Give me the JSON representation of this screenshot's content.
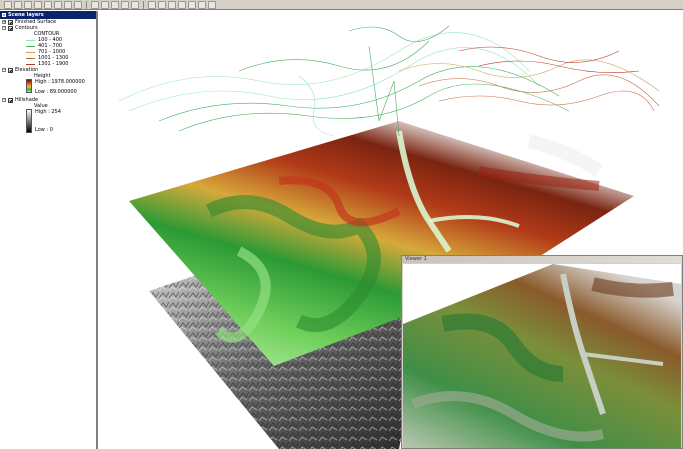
{
  "toolbar": {
    "buttons": [
      "new",
      "open",
      "save",
      "print",
      "cut",
      "copy",
      "paste",
      "delete",
      "add-data",
      "layer",
      "globe",
      "navigate",
      "fly",
      "zoom-in",
      "zoom-out",
      "pan",
      "full-extent",
      "select",
      "identify",
      "measure"
    ]
  },
  "toc": {
    "title": "Scene layers",
    "layers": [
      {
        "name": "Finished Surface",
        "checked": true,
        "expanded": false
      },
      {
        "name": "Contours",
        "checked": true,
        "expanded": true,
        "field": "CONTOUR",
        "classes": [
          {
            "label": "100 - 400",
            "color": "#9be3c6"
          },
          {
            "label": "401 - 700",
            "color": "#46b05a"
          },
          {
            "label": "701 - 1000",
            "color": "#c9a35b"
          },
          {
            "label": "1001 - 1300",
            "color": "#c86b3c"
          },
          {
            "label": "1301 - 1900",
            "color": "#b83a2a"
          }
        ]
      },
      {
        "name": "Elevation",
        "checked": true,
        "expanded": true,
        "field": "Height",
        "high": "High : 1978.000000",
        "low": "Low : 89.000000"
      },
      {
        "name": "Hillshade",
        "checked": true,
        "expanded": true,
        "field": "Value",
        "high": "High : 254",
        "low": "Low : 0"
      }
    ]
  },
  "viewer": {
    "title": "Viewer 1"
  },
  "colors": {
    "titlebar": "#0a246a",
    "elev_low": "#a8e9a0",
    "elev_mid": "#2f9e3a",
    "elev_upper": "#e0b23a",
    "elev_high": "#9a1f10",
    "snow": "#f4f4f4"
  }
}
